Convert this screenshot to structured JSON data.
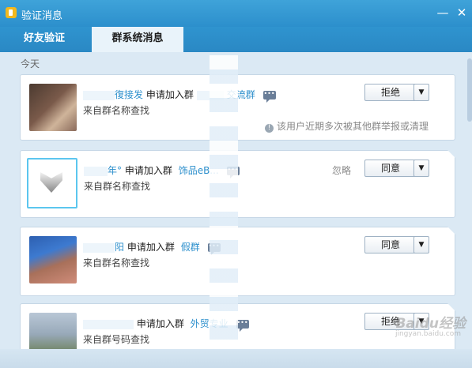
{
  "window": {
    "title": "验证消息",
    "minimize": "—",
    "close": "✕"
  },
  "tabs": [
    {
      "label": "好友验证"
    },
    {
      "label": "群系统消息"
    }
  ],
  "section": {
    "date_label": "今天"
  },
  "requests": [
    {
      "name": "復接发",
      "verb": "申请加入群",
      "group": "交流群",
      "source": "来自群名称查找",
      "warning": "该用户近期多次被其他群举报或清理",
      "action": "拒绝",
      "ignore": ""
    },
    {
      "name": "年°",
      "verb": "申请加入群",
      "group": "饰品eB...",
      "source": "来自群名称查找",
      "warning": "",
      "action": "同意",
      "ignore": "忽略"
    },
    {
      "name": "阳",
      "verb": "申请加入群",
      "group": "假群",
      "source": "来自群名称查找",
      "warning": "",
      "action": "同意",
      "ignore": ""
    },
    {
      "name": "",
      "verb": "申请加入群",
      "group": "外贸专业",
      "source": "来自群号码查找",
      "warning": "",
      "action": "拒绝",
      "ignore": ""
    }
  ],
  "watermark": {
    "main": "Baidu经验",
    "sub": "jingyan.baidu.com"
  },
  "icons": {
    "app": "speaker-icon",
    "message": "chat-bubble-icon",
    "dropdown": "chevron-down-icon",
    "warning": "info-icon"
  }
}
